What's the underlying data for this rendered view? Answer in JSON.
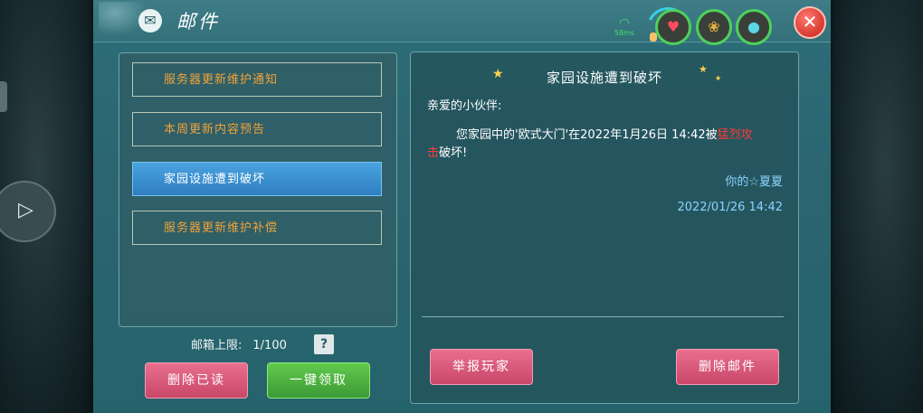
{
  "header": {
    "title": "邮件"
  },
  "status": {
    "ping": "58ms"
  },
  "mail_list": [
    {
      "label": "服务器更新维护通知",
      "active": false
    },
    {
      "label": "本周更新内容预告",
      "active": false
    },
    {
      "label": "家园设施遭到破坏",
      "active": true
    },
    {
      "label": "服务器更新维护补偿",
      "active": false
    }
  ],
  "quota": {
    "label": "邮箱上限:",
    "value": "1/100",
    "help": "?"
  },
  "left_buttons": {
    "delete_read": "删除已读",
    "claim_all": "一键领取"
  },
  "detail": {
    "title": "家园设施遭到破坏",
    "greeting": "亲爱的小伙伴:",
    "body_prefix": "您家园中的'欧式大门'在2022年1月26日 14:42被",
    "body_warn": "猛烈攻",
    "body_warn2": "击",
    "body_suffix": "破坏!",
    "signature": "你的☆夏夏",
    "date": "2022/01/26 14:42",
    "report_button": "举报玩家",
    "delete_button": "删除邮件"
  },
  "colors": {
    "accent_orange": "#f0a23a",
    "active_blue": "#3a8fd0",
    "warn_red": "#ff3a3a",
    "sign_blue": "#8ad3ff"
  }
}
